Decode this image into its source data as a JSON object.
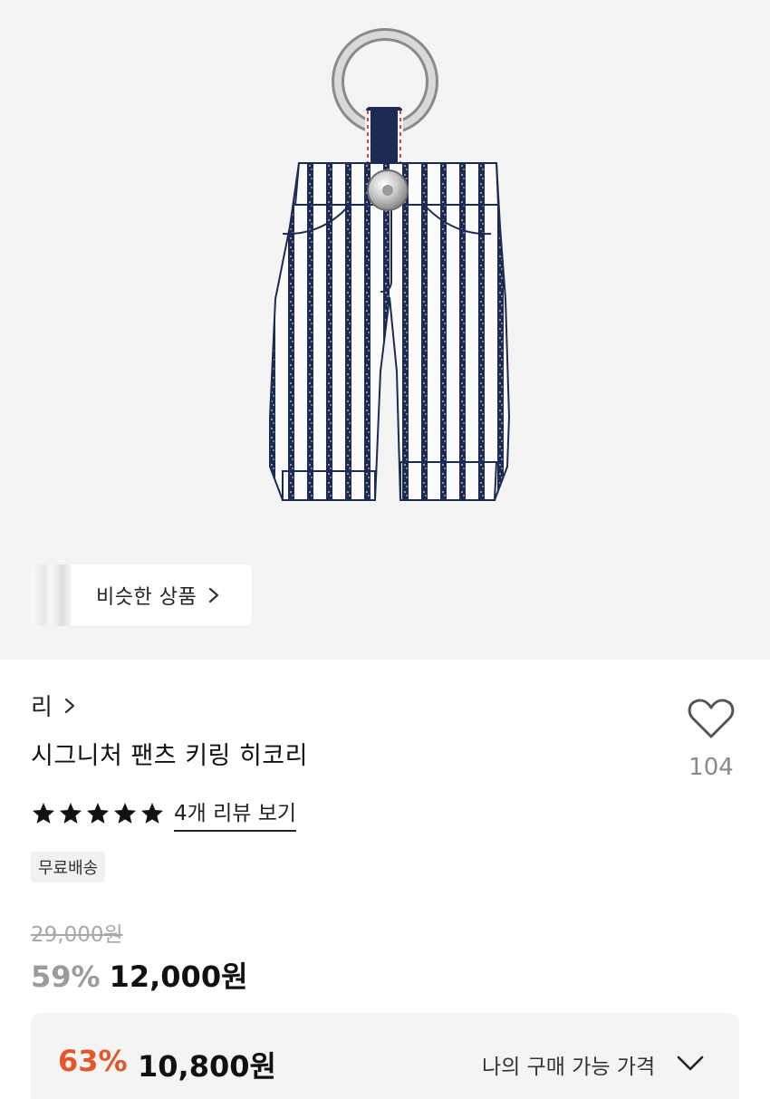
{
  "similar": {
    "label": "비슷한 상품",
    "chevron_icon": "chevron-right-icon"
  },
  "brand": {
    "name": "리",
    "chevron_icon": "chevron-right-icon"
  },
  "product": {
    "title": "시그니처 팬츠 키링 히코리"
  },
  "like": {
    "icon": "heart-outline-icon",
    "count": "104"
  },
  "rating": {
    "stars": 5,
    "review_link": "4개 리뷰 보기"
  },
  "badge": {
    "label": "무료배송"
  },
  "price": {
    "original": "29,000원",
    "discount": "59%",
    "sale": "12,000원"
  },
  "my_price": {
    "discount": "63%",
    "sale": "10,800원",
    "label": "나의 구매 가능 가격",
    "chevron_icon": "chevron-down-icon"
  },
  "colors": {
    "discount_accent": "#e2582b",
    "muted_discount": "#9b9b9b",
    "hero_bg": "#f4f4f4",
    "denim": "#1d2a52"
  }
}
